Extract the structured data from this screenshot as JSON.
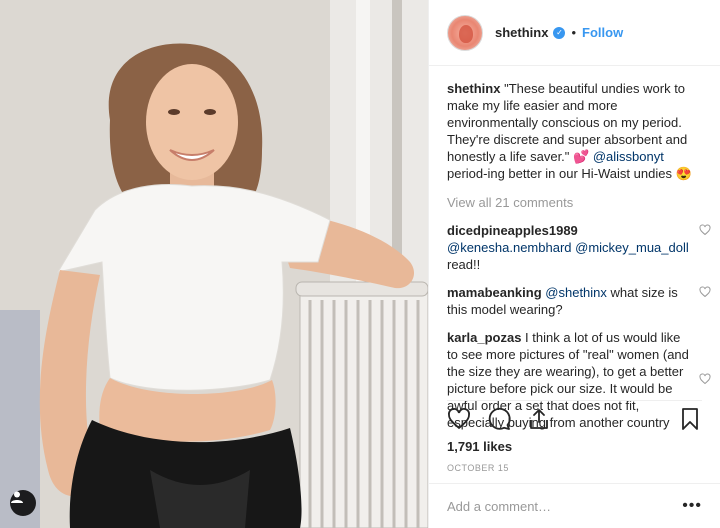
{
  "photo": {
    "alt_icon": "person-tag-icon"
  },
  "header": {
    "username": "shethinx",
    "verified_icon": "verified-badge-icon",
    "separator": "•",
    "follow_label": "Follow"
  },
  "caption": {
    "username": "shethinx",
    "text_1": "\"These beautiful undies work to make my life easier and more environmentally conscious on my period. They're discrete and super absorbent and honestly a life saver.\" 💕",
    "mention": "@alissbonyt",
    "text_2": "period-ing better in our Hi-Waist undies 😍"
  },
  "view_all": "View all 21 comments",
  "comments": [
    {
      "username": "dicedpineapples1989",
      "mention_1": "@kenesha.nembhard",
      "mention_2": "@mickey_mua_doll",
      "text": " read!!"
    },
    {
      "username": "mamabeanking",
      "mention_1": "@shethinx",
      "text": " what size is this model wearing?"
    },
    {
      "username": "karla_pozas",
      "text": " I think a lot of us would like to see more pictures of \"real\" women (and the size they are wearing), to get a better picture before pick our size. It would be awful order a set that does not fit, especially buying from another country"
    }
  ],
  "likes": "1,791 likes",
  "date": "OCTOBER 15",
  "add_comment_placeholder": "Add a comment…",
  "more_label": "•••",
  "colors": {
    "link_blue": "#3897f0",
    "mention_blue": "#003569",
    "muted": "#999999",
    "text": "#262626"
  }
}
